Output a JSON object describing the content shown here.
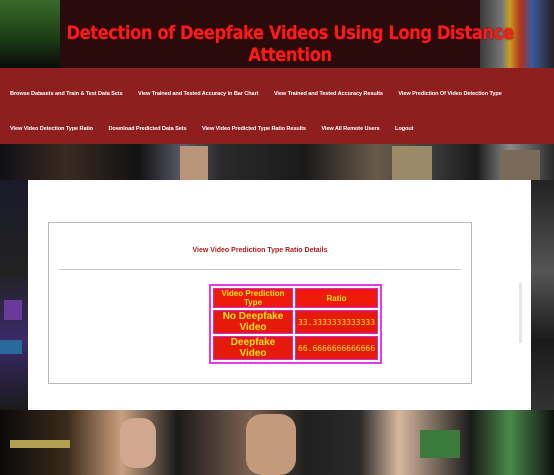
{
  "app": {
    "title": "Detection of Deepfake Videos Using Long Distance Attention"
  },
  "nav": {
    "row1": [
      "Browse Datasets and Train & Test Data Sets",
      "View Trained and Tested Accuracy in Bar Chart",
      "View Trained and Tested Accuracy Results",
      "View Prediction Of Video Detection Type"
    ],
    "row2": [
      "View Video Detection Type Ratio",
      "Download Predicted Data Sets",
      "View Video Predicted Type Ratio Results",
      "View All Remote Users",
      "Logout"
    ]
  },
  "content": {
    "heading": "View Video Prediction Type Ratio Details",
    "table": {
      "headers": [
        "Video Prediction Type",
        "Ratio"
      ],
      "rows": [
        {
          "type": "No Deepfake Video",
          "ratio": "33.3333333333333"
        },
        {
          "type": "Deepfake Video",
          "ratio": "66.6666666666666"
        }
      ]
    }
  },
  "colors": {
    "nav_bg": "#8f1e1e",
    "title_red": "#ff1a1a",
    "table_cell": "#e61a0a",
    "table_text": "#ffe21a",
    "table_border": "#e63ce6"
  }
}
